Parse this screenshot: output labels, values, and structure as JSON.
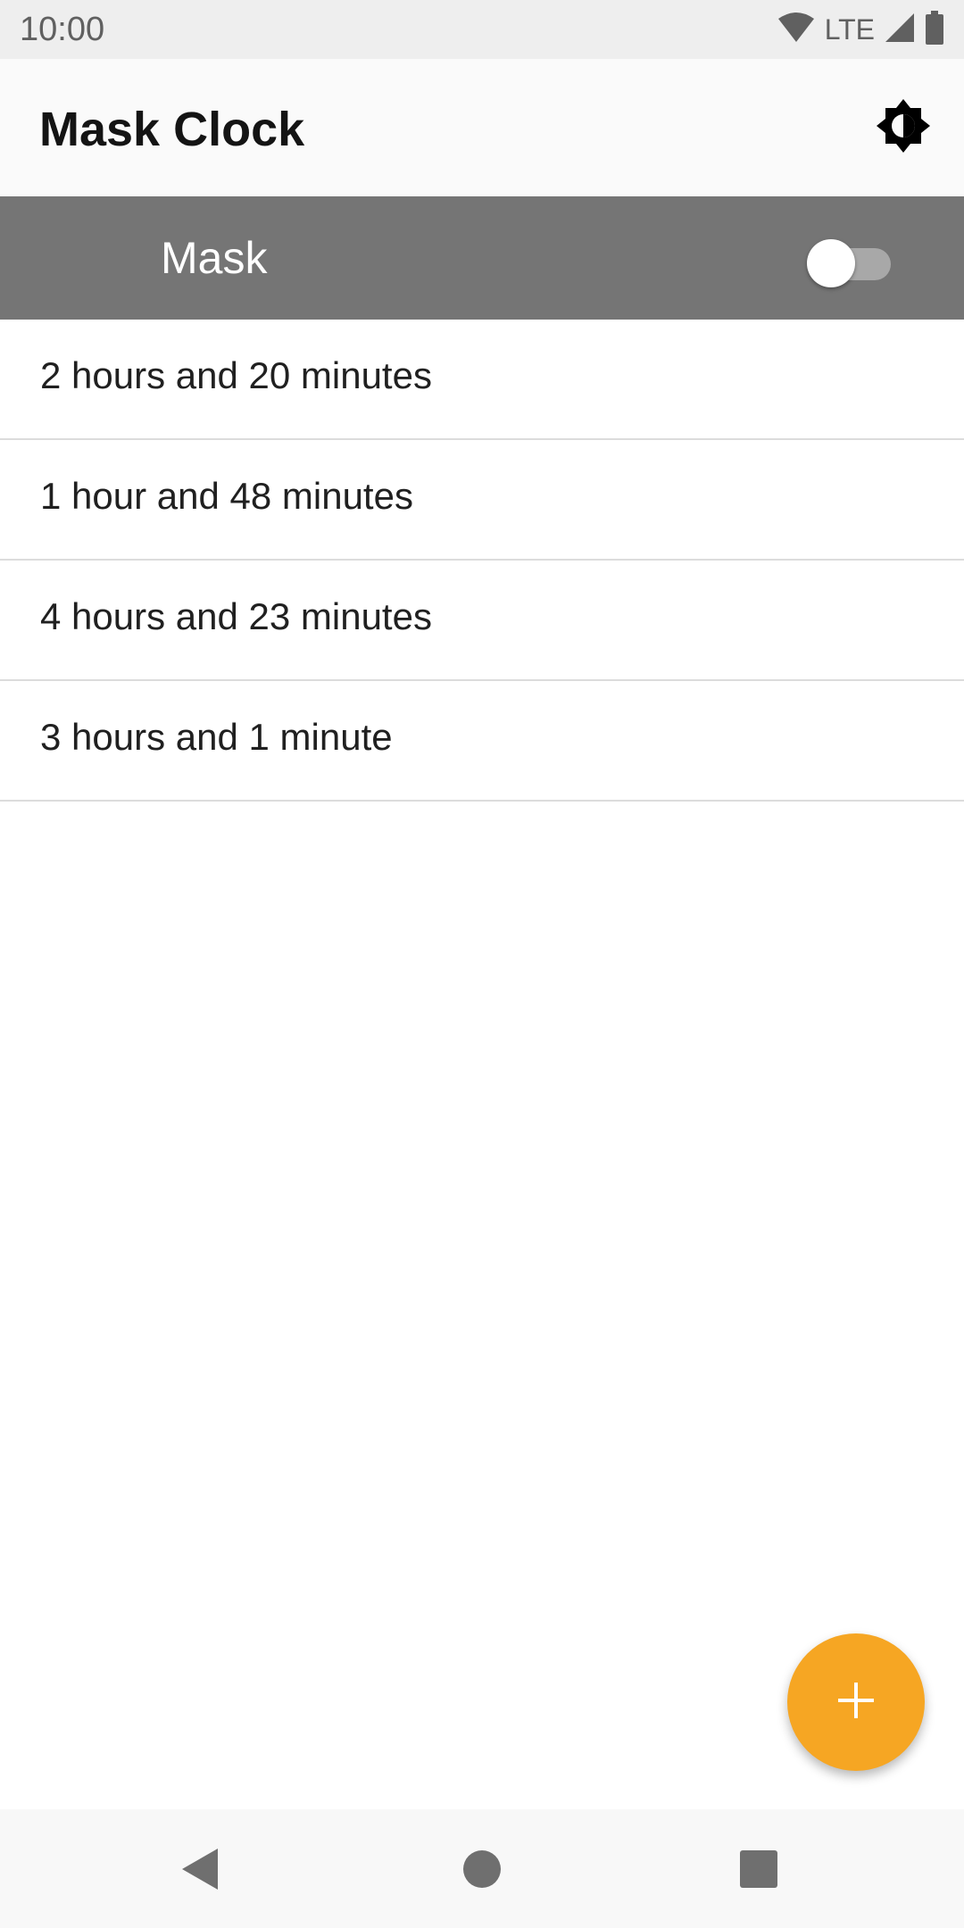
{
  "status_bar": {
    "time": "10:00",
    "network": "LTE",
    "icons": [
      "wifi-icon",
      "signal-icon",
      "battery-icon"
    ]
  },
  "app_bar": {
    "title": "Mask Clock",
    "theme_icon": "brightness-icon"
  },
  "mask_bar": {
    "label": "Mask",
    "toggle_on": false
  },
  "timers": [
    {
      "label": "2 hours and 20 minutes"
    },
    {
      "label": "1 hour and 48 minutes"
    },
    {
      "label": "4 hours and 23 minutes"
    },
    {
      "label": "3 hours and 1 minute"
    }
  ],
  "fab": {
    "icon": "add-icon"
  },
  "nav_bar": {
    "icons": [
      "back-icon",
      "home-icon",
      "recents-icon"
    ]
  },
  "colors": {
    "status_bar_bg": "#eeeeee",
    "app_bar_bg": "#fafafa",
    "mask_bar_bg": "#757575",
    "accent": "#f6a623",
    "nav_bar_bg": "#f8f8f8"
  }
}
